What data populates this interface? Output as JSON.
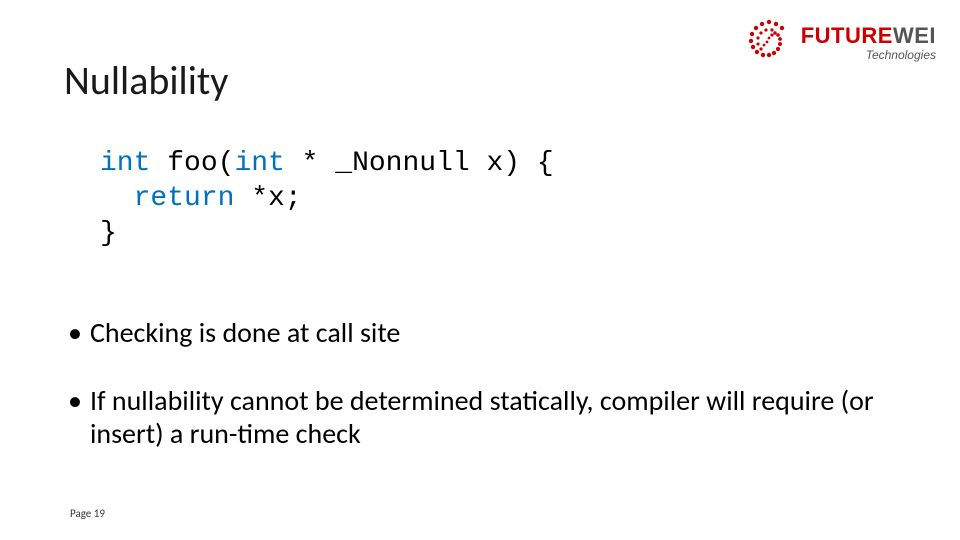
{
  "logo": {
    "main_red": "FUTURE",
    "main_gray": "WEI",
    "sub": "Technologies"
  },
  "title": "Nullability",
  "code": {
    "kw_int1": "int",
    "t1": " foo(",
    "kw_int2": "int",
    "t2": " * _Nonnull x) {",
    "line2a": "  ",
    "kw_return": "return",
    "line2b": " *x;",
    "line3": "}"
  },
  "bullets": [
    "Checking is done at call site",
    "If nullability cannot be determined statically, compiler will require (or insert) a run-time check"
  ],
  "page": "Page 19"
}
